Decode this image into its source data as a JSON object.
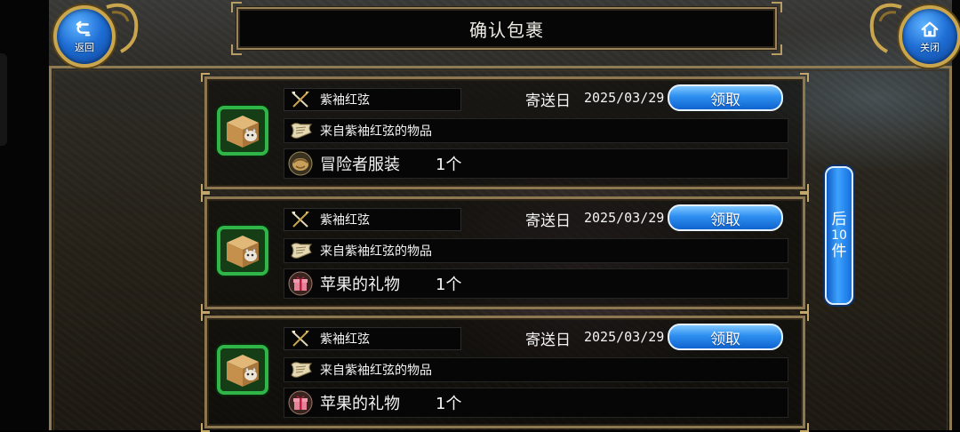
{
  "header": {
    "title": "确认包裹",
    "back_label": "返回",
    "close_label": "关闭"
  },
  "pagination": {
    "next_char1": "后",
    "next_num": "10",
    "next_char2": "件"
  },
  "mails": [
    {
      "sender": "紫袖红弦",
      "date_label": "寄送日",
      "date": "2025/03/29",
      "claim_label": "领取",
      "message": "来自紫袖红弦的物品",
      "item_name": "冒险者服装",
      "item_qty": "1个",
      "item_icon": "clothes-bundle-icon"
    },
    {
      "sender": "紫袖红弦",
      "date_label": "寄送日",
      "date": "2025/03/29",
      "claim_label": "领取",
      "message": "来自紫袖红弦的物品",
      "item_name": "苹果的礼物",
      "item_qty": "1个",
      "item_icon": "gift-box-icon"
    },
    {
      "sender": "紫袖红弦",
      "date_label": "寄送日",
      "date": "2025/03/29",
      "claim_label": "领取",
      "message": "来自紫袖红弦的物品",
      "item_name": "苹果的礼物",
      "item_qty": "1个",
      "item_icon": "gift-box-icon"
    }
  ],
  "colors": {
    "frame_gold": "#8c7750",
    "button_blue": "#2d8ef0",
    "icon_green": "#2fb548"
  }
}
